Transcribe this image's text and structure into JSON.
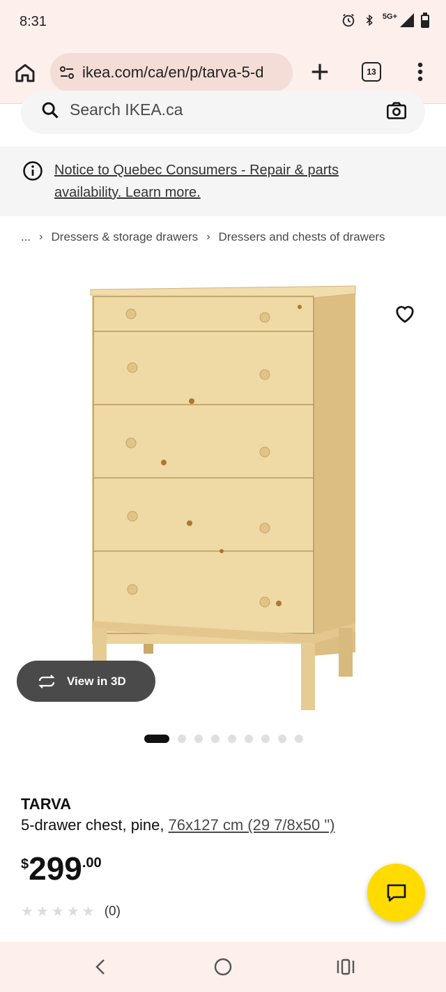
{
  "status_bar": {
    "time": "8:31",
    "network": "5G+",
    "icons": [
      "alarm-icon",
      "bluetooth-icon",
      "signal-icon",
      "battery-icon"
    ]
  },
  "browser": {
    "url": "ikea.com/ca/en/p/tarva-5-d",
    "tab_count": "13",
    "icons": [
      "home-icon",
      "site-info-icon",
      "new-tab-icon",
      "menu-icon"
    ]
  },
  "search": {
    "placeholder": "Search IKEA.ca"
  },
  "notice": {
    "text": "Notice to Quebec Consumers - Repair & parts availability. Learn more."
  },
  "breadcrumb": {
    "ellipsis": "...",
    "items": [
      "Dressers & storage drawers",
      "Dressers and chests of drawers"
    ]
  },
  "gallery": {
    "view_3d_label": "View in 3D",
    "image_count": 9,
    "active_index": 0
  },
  "product": {
    "name": "TARVA",
    "description": "5-drawer chest, pine, ",
    "dimensions": "76x127 cm (29 7/8x50 \")",
    "price": {
      "currency": "$",
      "integer": "299",
      "decimal": ".00"
    },
    "rating": {
      "stars": 0,
      "max": 5,
      "count": "(0)"
    }
  },
  "colors": {
    "chrome_bg": "#fcefec",
    "url_pill": "#f3ddd6",
    "chat_button": "#ffdb00",
    "wood": "#ecd49c"
  }
}
